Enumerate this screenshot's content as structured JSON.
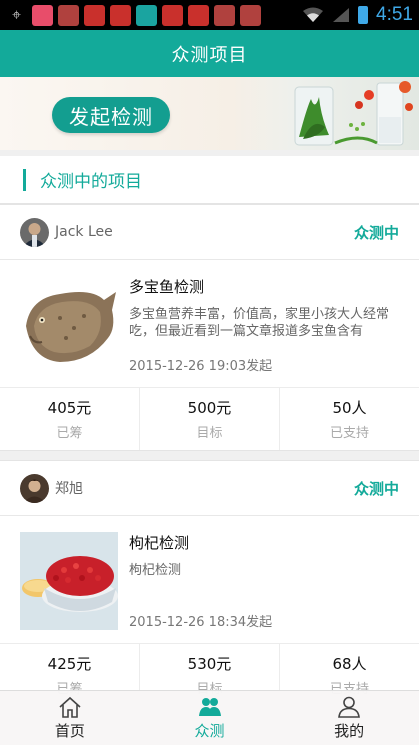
{
  "status_bar": {
    "time": "4:51",
    "icons": [
      "gps-icon",
      "notification-app-icon",
      "notification-app-icon",
      "notification-app-icon",
      "notification-app-icon",
      "notification-app-icon",
      "notification-app-icon",
      "notification-app-icon",
      "notification-app-icon",
      "notification-app-icon"
    ]
  },
  "header": {
    "title": "众测项目"
  },
  "banner": {
    "button_label": "发起检测"
  },
  "section": {
    "title": "众测中的项目"
  },
  "projects": [
    {
      "author": "Jack  Lee",
      "status": "众测中",
      "title": "多宝鱼检测",
      "description": "多宝鱼营养丰富，价值高，家里小孩大人经常吃，但最近看到一篇文章报道多宝鱼含有",
      "date": "2015-12-26 19:03发起",
      "stats": [
        {
          "value": "405元",
          "label": "已筹"
        },
        {
          "value": "500元",
          "label": "目标"
        },
        {
          "value": "50人",
          "label": "已支持"
        }
      ]
    },
    {
      "author": "郑旭",
      "status": "众测中",
      "title": "枸杞检测",
      "description": "枸杞检测",
      "date": "2015-12-26 18:34发起",
      "stats": [
        {
          "value": "425元",
          "label": "已筹"
        },
        {
          "value": "530元",
          "label": "目标"
        },
        {
          "value": "68人",
          "label": "已支持"
        }
      ]
    }
  ],
  "bottom_nav": {
    "items": [
      {
        "label": "首页",
        "icon": "home-icon",
        "active": false
      },
      {
        "label": "众测",
        "icon": "crowd-test-icon",
        "active": true
      },
      {
        "label": "我的",
        "icon": "profile-icon",
        "active": false
      }
    ]
  },
  "colors": {
    "accent": "#13aa9a",
    "status_bar": "#000000",
    "status_time": "#3fa9e8"
  }
}
